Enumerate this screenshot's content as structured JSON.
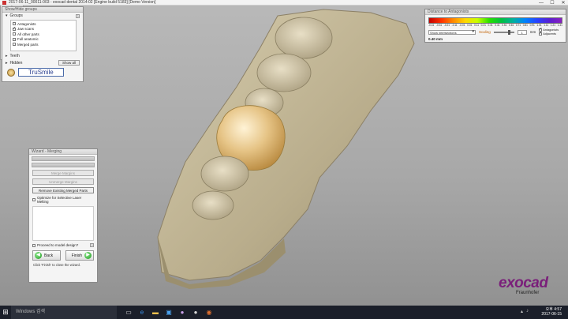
{
  "window": {
    "title": "2017-06-11_00011-003 - exocad dental 2014:02 [Engine build 5183] [Demo Version]",
    "minimize": "—",
    "maximize": "☐",
    "close": "✕"
  },
  "groups_panel": {
    "title": "Show/Hide groups",
    "groups_label": "Groups",
    "help": "?",
    "items": [
      {
        "label": "Antagonists",
        "checked": false
      },
      {
        "label": "Jaw scans",
        "checked": true
      },
      {
        "label": "All other parts",
        "checked": false
      },
      {
        "label": "Full anatomic",
        "checked": false
      },
      {
        "label": "Merged parts",
        "checked": false
      }
    ],
    "teeth_label": "Teeth",
    "hidden_label": "Hidden",
    "show_all": "Show all",
    "trusmile": "TruSmile"
  },
  "distance_panel": {
    "title": "Distance to Antagonists",
    "ticks": [
      "-0.41",
      "-0.31",
      "-0.21",
      "-0.11",
      "-0.01",
      "0.01",
      "0.11",
      "0.21",
      "0.31",
      "0.41",
      "0.51",
      "0.61",
      "0.71",
      "0.81",
      "0.91",
      "1.01",
      "1.11",
      "1.21",
      "1.31"
    ],
    "mode": "Show intersections",
    "scaling_label": "Scaling",
    "scaling_value": "1",
    "unit": "mm",
    "antagonists_label": "Antagonists",
    "adjacents_label": "Adjacents",
    "distance_value": "0.40 mm"
  },
  "wizard": {
    "title": "Wizard - Merging",
    "merge_button": "Merge Margins",
    "unmerge_button": "Unmerge Margins",
    "remove_button": "Remove Existing Merged Parts",
    "optimize_label": "Optimize for Selective Laser Melting",
    "proceed_label": "Proceed to model design?",
    "back": "Back",
    "finish": "Finish",
    "hint": "Click 'Finish' to close the wizard."
  },
  "tools": {
    "help": "?"
  },
  "brand": {
    "logo": "exocad",
    "sub": "Fraunhofer"
  },
  "taskbar": {
    "search": "Windows 검색",
    "time": "오후 4:57",
    "date": "2017-06-15"
  },
  "colors": {
    "crown": "#e8c98a",
    "model": "#c8bd9c",
    "accent": "#2a3f8f"
  }
}
